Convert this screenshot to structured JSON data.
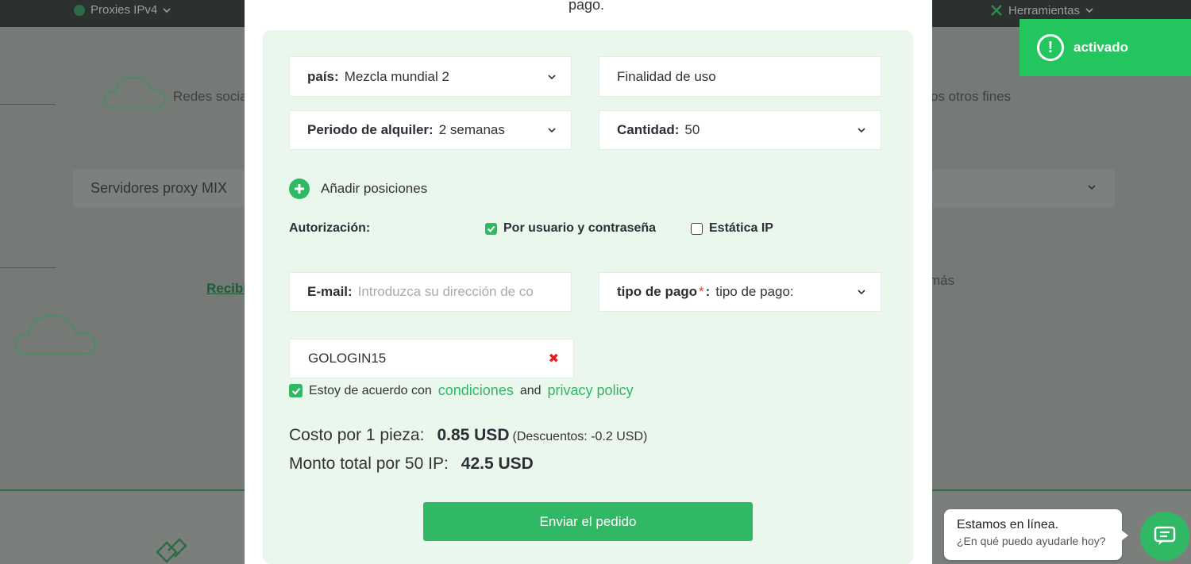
{
  "background": {
    "nav_left": "Proxies IPv4",
    "nav_right": "Herramientas",
    "social_text": "Redes socia",
    "other_text": "os otros fines",
    "select_text": "Servidores proxy MIX",
    "link_text": "Recibi",
    "more_text": "más"
  },
  "modal": {
    "top_text": "pago.",
    "country": {
      "label": "país:",
      "value": "Mezcla mundial 2"
    },
    "purpose": {
      "value": "Finalidad de uso"
    },
    "period": {
      "label": "Periodo de alquiler:",
      "value": "2 semanas"
    },
    "quantity": {
      "label": "Cantidad:",
      "value": "50"
    },
    "add_positions": "Añadir posiciones",
    "authorization": {
      "label": "Autorización:",
      "option1": "Por usuario y contraseña",
      "option1_checked": true,
      "option2": "Estática IP",
      "option2_checked": false
    },
    "email": {
      "label": "E-mail:",
      "placeholder": "Introduzca su dirección de co"
    },
    "payment": {
      "label": "tipo de pago",
      "required_mark": "*",
      "colon": ":",
      "value": "tipo de pago:"
    },
    "coupon": {
      "value": "GOLOGIN15"
    },
    "agree": {
      "prefix": "Estoy de acuerdo con",
      "link1": "condiciones",
      "and": "and",
      "link2": "privacy policy",
      "checked": true
    },
    "cost_per_piece": {
      "label": "Costo por 1 pieza:",
      "value": "0.85 USD",
      "discount": "(Descuentos: -0.2 USD)"
    },
    "total": {
      "label": "Monto total por 50 IP:",
      "value": "42.5 USD"
    },
    "submit_label": "Enviar el pedido"
  },
  "toast": {
    "text": "activado",
    "color": "#22c55e"
  },
  "chat": {
    "line1": "Estamos en línea.",
    "line2": "¿En qué puedo ayudarle hoy?"
  },
  "colors": {
    "accent": "#31b864",
    "panel": "#e9f7ec",
    "overlay": "#757a77"
  }
}
